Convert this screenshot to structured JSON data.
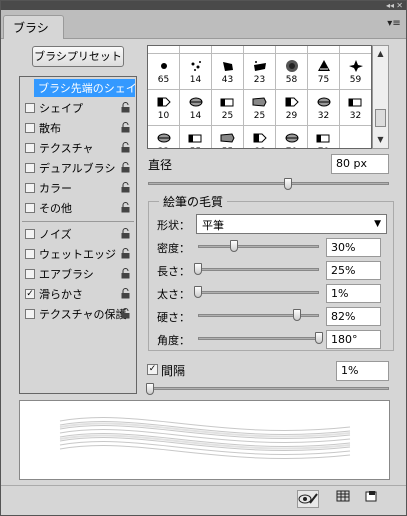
{
  "panel": {
    "tab_label": "ブラシ",
    "preset_button": "ブラシプリセット"
  },
  "options": [
    {
      "label": "ブラシ先端のシェイプ",
      "checkbox": false,
      "checked": false,
      "lock": false,
      "selected": true
    },
    {
      "label": "シェイプ",
      "checkbox": true,
      "checked": false,
      "lock": true
    },
    {
      "label": "散布",
      "checkbox": true,
      "checked": false,
      "lock": true
    },
    {
      "label": "テクスチャ",
      "checkbox": true,
      "checked": false,
      "lock": true
    },
    {
      "label": "デュアルブラシ",
      "checkbox": true,
      "checked": false,
      "lock": true
    },
    {
      "label": "カラー",
      "checkbox": true,
      "checked": false,
      "lock": true
    },
    {
      "label": "その他",
      "checkbox": true,
      "checked": false,
      "lock": true
    },
    {
      "label": "ノイズ",
      "checkbox": true,
      "checked": false,
      "lock": true
    },
    {
      "label": "ウェットエッジ",
      "checkbox": true,
      "checked": false,
      "lock": true
    },
    {
      "label": "エアブラシ",
      "checkbox": true,
      "checked": false,
      "lock": true
    },
    {
      "label": "滑らかさ",
      "checkbox": true,
      "checked": true,
      "lock": true
    },
    {
      "label": "テクスチャの保護",
      "checkbox": true,
      "checked": false,
      "lock": true
    }
  ],
  "brush_tips": [
    [
      "45",
      "62",
      "40",
      "45",
      "90",
      "21",
      "60"
    ],
    [
      "65",
      "14",
      "43",
      "23",
      "58",
      "75",
      "59"
    ],
    [
      "10",
      "14",
      "25",
      "25",
      "29",
      "32",
      "32"
    ],
    [
      "32",
      "55",
      "55",
      "66",
      "70",
      "70",
      ""
    ]
  ],
  "diameter": {
    "label": "直径",
    "value": "80 px",
    "slider": 0.58
  },
  "bristle": {
    "title": "絵筆の毛質",
    "shape_label": "形状：",
    "shape_value": "平筆",
    "params": [
      {
        "label": "密度：",
        "value": "30%",
        "slider": 0.3
      },
      {
        "label": "長さ：",
        "value": "25%",
        "slider": 0.0
      },
      {
        "label": "太さ：",
        "value": "1%",
        "slider": 0.0
      },
      {
        "label": "硬さ：",
        "value": "82%",
        "slider": 0.82
      },
      {
        "label": "角度：",
        "value": "180°",
        "slider": 1.0
      }
    ]
  },
  "spacing": {
    "label": "間隔",
    "value": "1%",
    "checked": true,
    "slider": 0.0
  }
}
